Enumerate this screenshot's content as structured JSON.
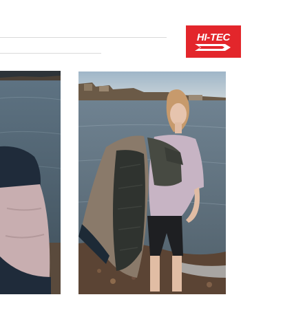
{
  "brand": {
    "logo_text": "HI-TEC",
    "accent_color": "#e3262b"
  },
  "images": [
    {
      "name": "photo-left",
      "description_icon": "fleece-sleeve-photo"
    },
    {
      "name": "photo-right",
      "description_icon": "model-by-river-photo"
    }
  ]
}
